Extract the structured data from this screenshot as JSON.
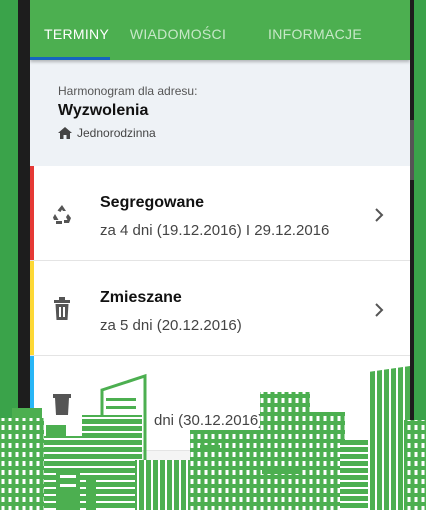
{
  "tabs": [
    {
      "label": "TERMINY",
      "active": true
    },
    {
      "label": "WIADOMOŚCI",
      "active": false
    },
    {
      "label": "INFORMACJE",
      "active": false
    }
  ],
  "header": {
    "label": "Harmonogram dla adresu:",
    "street": "Wyzwolenia",
    "building_type": "Jednorodzinna",
    "building_icon": "home-icon"
  },
  "items": [
    {
      "title": "Segregowane",
      "subtitle": "za 4 dni (19.12.2016)  I  29.12.2016",
      "icon": "recycle-icon",
      "color": "#e53935"
    },
    {
      "title": "Zmieszane",
      "subtitle": "za 5 dni (20.12.2016)",
      "icon": "trash-icon",
      "color": "#fdd835"
    },
    {
      "title": "",
      "subtitle": "dni (30.12.2016)",
      "icon": "bin-icon",
      "color": "#29b6f6"
    }
  ],
  "colors": {
    "tab_bar": "#4caf50",
    "active_indicator": "#1565c0",
    "frame_accent": "#3aa34a",
    "skyline": "#4caf50"
  }
}
